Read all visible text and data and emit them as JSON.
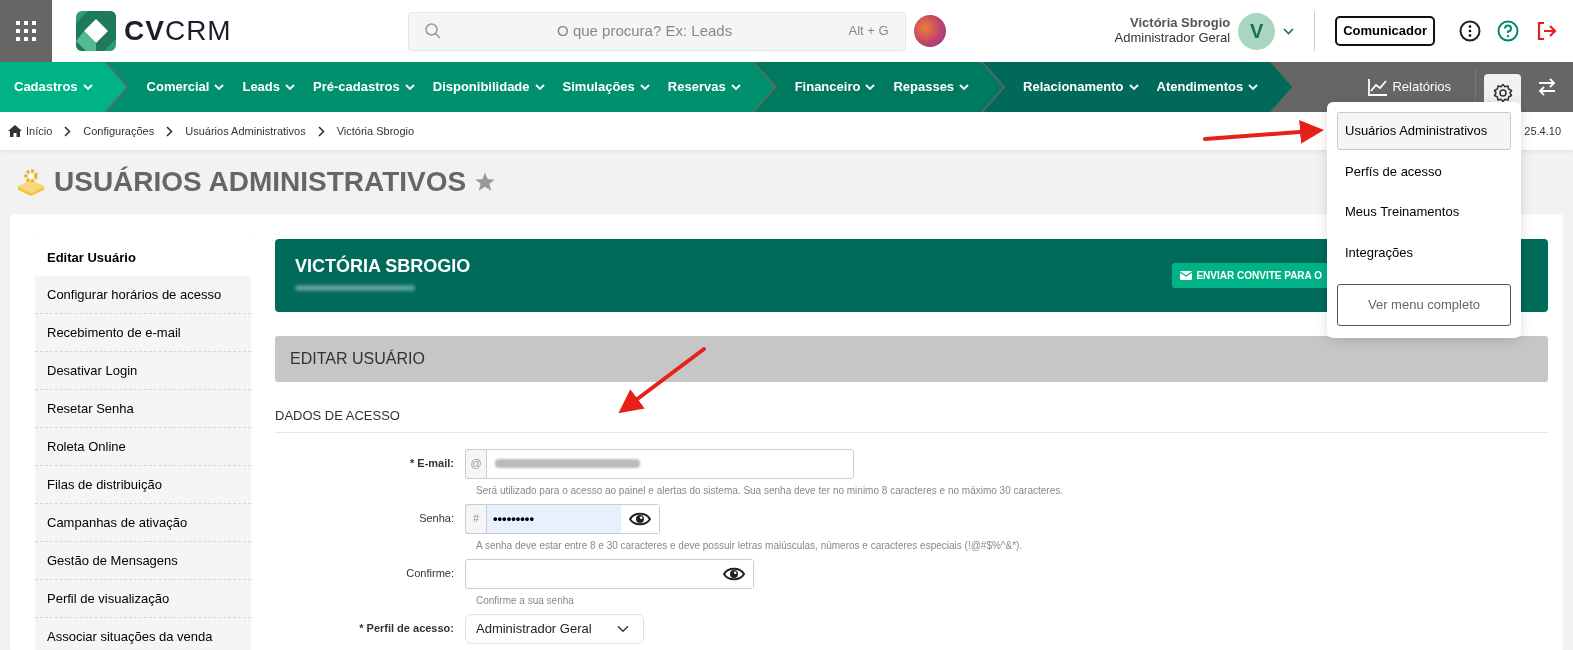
{
  "header": {
    "logo": {
      "bold": "CV",
      "light": "CRM"
    },
    "search": {
      "placeholder": "O que procura? Ex: Leads",
      "shortcut": "Alt + G"
    },
    "user": {
      "name": "Victória Sbrogio",
      "role": "Administrador Geral",
      "initial": "V"
    },
    "communicator": "Comunicador"
  },
  "nav": {
    "groups": [
      {
        "color": "#00b386",
        "items": [
          "Cadastros"
        ]
      },
      {
        "color": "#00906e",
        "items": [
          "Comercial",
          "Leads",
          "Pré-cadastros",
          "Disponibilidade",
          "Simulações",
          "Reservas"
        ]
      },
      {
        "color": "#007a5e",
        "items": [
          "Financeiro",
          "Repasses"
        ]
      },
      {
        "color": "#00695a",
        "items": [
          "Relacionamento",
          "Atendimentos"
        ]
      }
    ],
    "reports": "Relatórios"
  },
  "breadcrumb": {
    "items": [
      "Início",
      "Configurações",
      "Usuários Administrativos",
      "Victória Sbrogio"
    ],
    "version": "25.4.10"
  },
  "page_title": "USUÁRIOS ADMINISTRATIVOS",
  "favorite": false,
  "sidebar": {
    "items": [
      {
        "label": "Editar Usuário",
        "selected": true
      },
      {
        "label": "Configurar horários de acesso",
        "selected": false
      },
      {
        "label": "Recebimento de e-mail",
        "selected": false
      },
      {
        "label": "Desativar Login",
        "selected": false
      },
      {
        "label": "Resetar Senha",
        "selected": false
      },
      {
        "label": "Roleta Online",
        "selected": false
      },
      {
        "label": "Filas de distribuição",
        "selected": false
      },
      {
        "label": "Campanhas de ativação",
        "selected": false
      },
      {
        "label": "Gestão de Mensagens",
        "selected": false
      },
      {
        "label": "Perfil de visualização",
        "selected": false
      },
      {
        "label": "Associar situações da venda",
        "selected": false
      }
    ]
  },
  "profile": {
    "name": "VICTÓRIA SBROGIO",
    "invite_button": "ENVIAR CONVITE PARA O"
  },
  "section_title": "EDITAR USUÁRIO",
  "form": {
    "heading": "DADOS DE ACESSO",
    "fields": [
      {
        "kind": "email",
        "label": "* E-mail:",
        "required": true,
        "addon": "@",
        "help": "Será utilizado para o acesso ao painel e alertas do sistema. Sua senha deve ter no minimo 8 caracteres e no máximo 30 caracteres."
      },
      {
        "kind": "password",
        "label": "Senha:",
        "required": false,
        "addon": "#",
        "value": "•••••••••",
        "help": "A senha deve estar entre 8 e 30 caracteres e deve possuir letras maiúsculas, números e caracteres especiais (!@#$%^&*)."
      },
      {
        "kind": "password",
        "label": "Confirme:",
        "required": false,
        "help": "Confirme a sua senha"
      },
      {
        "kind": "select",
        "label": "* Perfil de acesso:",
        "required": true,
        "value": "Administrador Geral"
      }
    ]
  },
  "settings_menu": {
    "items": [
      {
        "label": "Usuários Administrativos",
        "selected": true
      },
      {
        "label": "Perfís de acesso",
        "selected": false
      },
      {
        "label": "Meus Treinamentos",
        "selected": false
      },
      {
        "label": "Integrações",
        "selected": false
      }
    ],
    "full_menu_button": "Ver menu completo"
  }
}
